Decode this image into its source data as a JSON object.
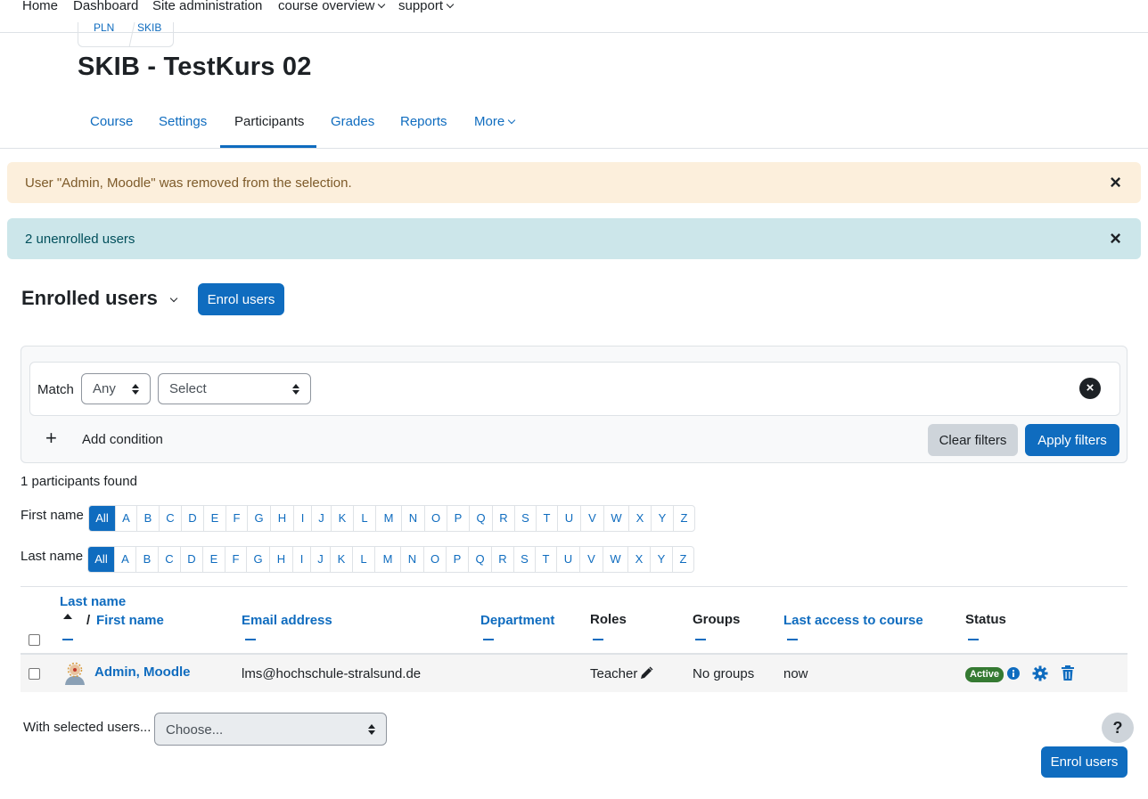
{
  "topnav": {
    "items": [
      "Home",
      "Dashboard",
      "Site administration",
      "course overview",
      "support"
    ]
  },
  "course_image_text": [
    "PLN",
    "SKIB"
  ],
  "page_title": "SKIB - TestKurs 02",
  "secnav": {
    "tabs": [
      "Course",
      "Settings",
      "Participants",
      "Grades",
      "Reports",
      "More"
    ],
    "active": "Participants"
  },
  "alerts": {
    "warning": "User \"Admin, Moodle\" was removed from the selection.",
    "info": "2 unenrolled users",
    "close": "×"
  },
  "enrolled": {
    "title": "Enrolled users",
    "enrol_button": "Enrol users"
  },
  "filters": {
    "match_label": "Match",
    "match_value": "Any",
    "select_value": "Select",
    "add_condition": "Add condition",
    "add_icon": "+",
    "remove_icon": "×",
    "clear_button": "Clear filters",
    "apply_button": "Apply filters"
  },
  "participants_found": "1 participants found",
  "initials": {
    "first_label": "First name",
    "last_label": "Last name",
    "letters": [
      "All",
      "A",
      "B",
      "C",
      "D",
      "E",
      "F",
      "G",
      "H",
      "I",
      "J",
      "K",
      "L",
      "M",
      "N",
      "O",
      "P",
      "Q",
      "R",
      "S",
      "T",
      "U",
      "V",
      "W",
      "X",
      "Y",
      "Z"
    ]
  },
  "table": {
    "headers": {
      "last_name": "Last name",
      "first_name": "First name",
      "separator": "/",
      "email": "Email address",
      "department": "Department",
      "roles": "Roles",
      "groups": "Groups",
      "last_access": "Last access to course",
      "status": "Status"
    },
    "rows": [
      {
        "name": "Admin, Moodle",
        "email": "lms@hochschule-stralsund.de",
        "department": "",
        "role": "Teacher",
        "groups": "No groups",
        "last_access": "now",
        "status": "Active"
      }
    ]
  },
  "bulk": {
    "label": "With selected users...",
    "placeholder": "Choose..."
  },
  "help": "?",
  "colors": {
    "primary": "#0f6cbf",
    "warning_bg": "#fcefdc",
    "info_bg": "#cce6ea",
    "active_badge": "#357a32"
  }
}
